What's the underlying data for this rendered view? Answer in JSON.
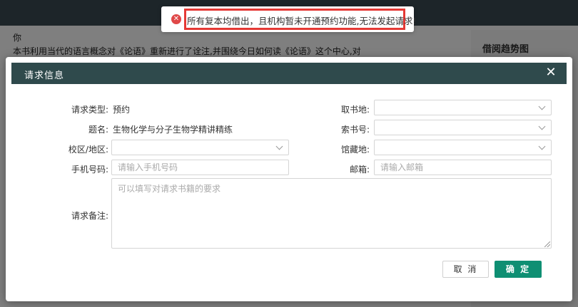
{
  "toast": {
    "message": "所有复本均借出，且机构暂未开通预约功能,无法发起请求!",
    "icon": "error-circle-icon",
    "color": "#e04848"
  },
  "background_page": {
    "text_line_1": "本书利用当代的语言概念对《论语》重新进行了诠注,并围绕今日如何读《论语》这个中心,对",
    "side_title": "借阅趋势图"
  },
  "modal": {
    "title": "请求信息",
    "close_symbol": "✕",
    "fields": {
      "request_type": {
        "label": "请求类型:",
        "value": "预约"
      },
      "title": {
        "label": "题名:",
        "value": "生物化学与分子生物学精讲精练"
      },
      "campus": {
        "label": "校区/地区:",
        "value": ""
      },
      "phone": {
        "label": "手机号码:",
        "placeholder": "请输入手机号码"
      },
      "notes": {
        "label": "请求备注:",
        "placeholder": "可以填写对请求书籍的要求"
      },
      "pickup_location": {
        "label": "取书地:",
        "value": ""
      },
      "call_number": {
        "label": "索书号:",
        "value": ""
      },
      "collection_location": {
        "label": "馆藏地:",
        "value": ""
      },
      "email": {
        "label": "邮箱:",
        "placeholder": "请输入邮箱"
      }
    },
    "buttons": {
      "cancel": "取 消",
      "confirm": "确 定"
    }
  },
  "colors": {
    "header_bg": "#2f4a4c",
    "confirm_bg": "#0f8f73",
    "highlight_border": "#e53935"
  }
}
